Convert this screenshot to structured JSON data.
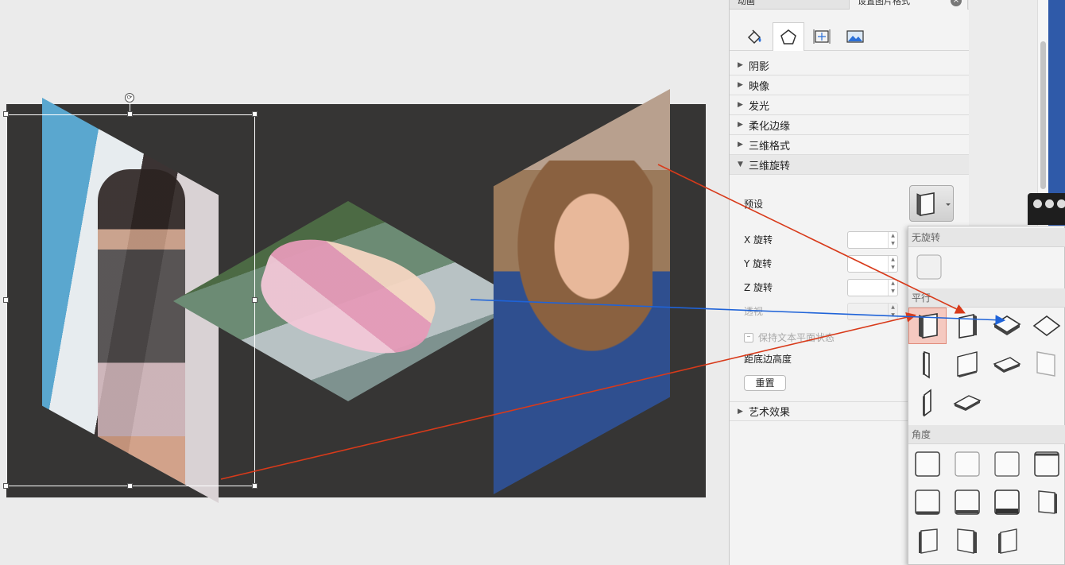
{
  "panel": {
    "tabs": [
      "动画",
      "设置图片格式"
    ],
    "sections": {
      "shadow": "阴影",
      "reflection": "映像",
      "glow": "发光",
      "soft_edges": "柔化边缘",
      "format_3d": "三维格式",
      "rotation_3d": "三维旋转",
      "artistic": "艺术效果"
    },
    "rotation": {
      "preset_label": "预设",
      "x_label": "X 旋转",
      "y_label": "Y 旋转",
      "z_label": "Z 旋转",
      "perspective_label": "透视",
      "keep_flat_label": "保持文本平面状态",
      "distance_label": "距底边高度",
      "reset_label": "重置",
      "x_value": "",
      "y_value": "",
      "z_value": "",
      "perspective_value": ""
    }
  },
  "popup": {
    "no_rotation_header": "无旋转",
    "parallel_header": "平行",
    "angle_header": "角度"
  },
  "icons": {
    "fill": "paint-bucket-icon",
    "shape": "pentagon-icon",
    "size": "size-position-icon",
    "picture": "picture-icon"
  },
  "colors": {
    "slide_bg": "#363534",
    "arrow_red": "#d83a1a",
    "arrow_blue": "#1f63d8",
    "selected_tile": "#f5c9c0"
  }
}
